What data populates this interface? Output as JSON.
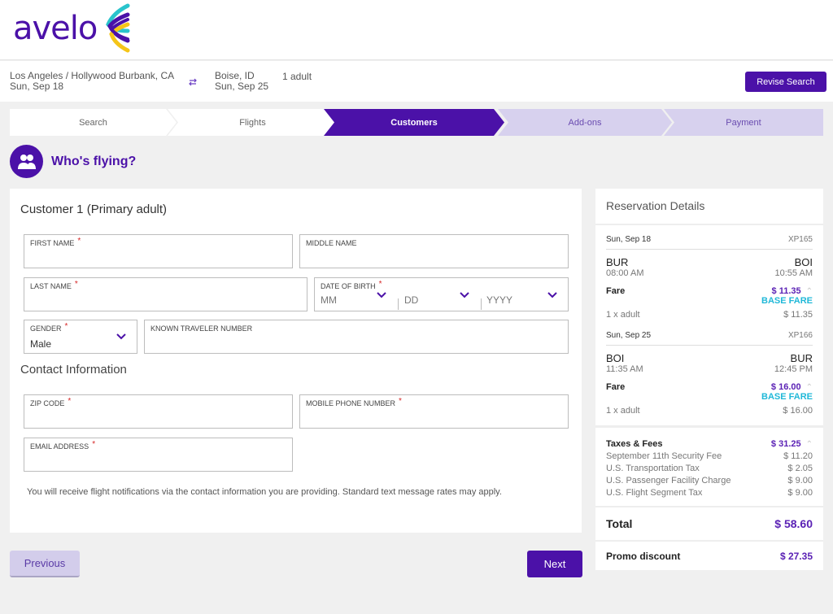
{
  "brand": {
    "name": "avelo",
    "color": "#4b11a8"
  },
  "search_summary": {
    "origin": "Los Angeles / Hollywood Burbank, CA",
    "depart_date": "Sun, Sep 18",
    "destination": "Boise, ID",
    "return_date": "Sun, Sep 25",
    "passengers": "1 adult",
    "revise_label": "Revise Search"
  },
  "steps": [
    {
      "label": "Search",
      "state": "done"
    },
    {
      "label": "Flights",
      "state": "done"
    },
    {
      "label": "Customers",
      "state": "active"
    },
    {
      "label": "Add-ons",
      "state": "upcoming"
    },
    {
      "label": "Payment",
      "state": "upcoming"
    }
  ],
  "page_title": "Who's flying?",
  "form": {
    "title": "Customer 1 (Primary adult)",
    "fields": {
      "first_name": {
        "label": "FIRST NAME",
        "required": "*",
        "value": ""
      },
      "middle_name": {
        "label": "MIDDLE NAME",
        "value": ""
      },
      "last_name": {
        "label": "LAST NAME",
        "required": "*",
        "value": ""
      },
      "dob": {
        "label": "DATE OF BIRTH",
        "required": "*",
        "month": "MM",
        "day": "DD",
        "year": "YYYY"
      },
      "gender": {
        "label": "GENDER",
        "required": "*",
        "value": "Male"
      },
      "ktn": {
        "label": "KNOWN TRAVELER NUMBER",
        "value": ""
      },
      "zip": {
        "label": "ZIP CODE",
        "required": "*",
        "value": ""
      },
      "phone": {
        "label": "MOBILE PHONE NUMBER",
        "required": "*",
        "value": ""
      },
      "email": {
        "label": "EMAIL ADDRESS",
        "required": "*",
        "value": ""
      }
    },
    "contact_title": "Contact Information",
    "notice": "You will receive flight notifications via the contact information you are providing. Standard text message rates may apply."
  },
  "nav": {
    "previous": "Previous",
    "next": "Next"
  },
  "reservation": {
    "title": "Reservation Details",
    "flights": [
      {
        "date": "Sun, Sep 18",
        "flight_no": "XP165",
        "from": "BUR",
        "from_time": "08:00 AM",
        "to": "BOI",
        "to_time": "10:55 AM",
        "fare_label": "Fare",
        "fare": "$ 11.35",
        "fare_type": "BASE FARE",
        "pax_label": "1 x adult",
        "pax_price": "$ 11.35"
      },
      {
        "date": "Sun, Sep 25",
        "flight_no": "XP166",
        "from": "BOI",
        "from_time": "11:35 AM",
        "to": "BUR",
        "to_time": "12:45 PM",
        "fare_label": "Fare",
        "fare": "$ 16.00",
        "fare_type": "BASE FARE",
        "pax_label": "1 x adult",
        "pax_price": "$ 16.00"
      }
    ],
    "taxes": {
      "label": "Taxes & Fees",
      "total": "$ 31.25",
      "items": [
        {
          "name": "September 11th Security Fee",
          "amount": "$ 11.20"
        },
        {
          "name": "U.S. Transportation Tax",
          "amount": "$ 2.05"
        },
        {
          "name": "U.S. Passenger Facility Charge",
          "amount": "$ 9.00"
        },
        {
          "name": "U.S. Flight Segment Tax",
          "amount": "$ 9.00"
        }
      ]
    },
    "total_label": "Total",
    "total": "$ 58.60",
    "promo_label": "Promo discount",
    "promo": "$ 27.35"
  }
}
